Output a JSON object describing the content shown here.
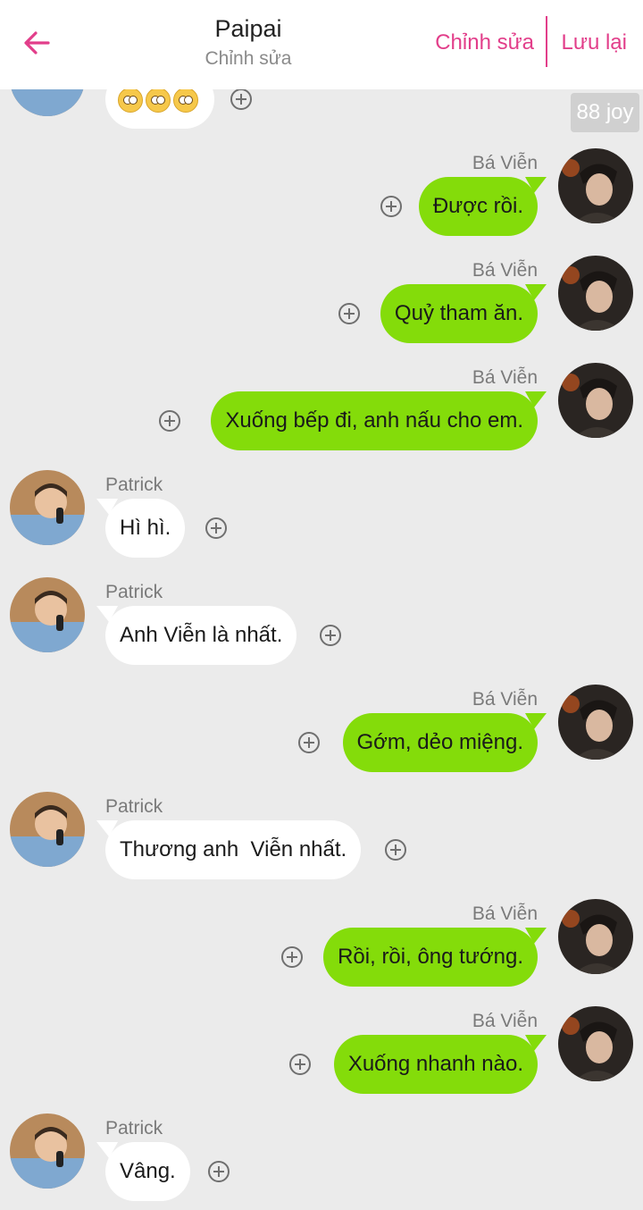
{
  "header": {
    "title": "Paipai",
    "subtitle": "Chỉnh sửa",
    "edit_label": "Chỉnh sửa",
    "save_label": "Lưu lại",
    "accent_color": "#e23e8a"
  },
  "watermark": "88 joy",
  "colors": {
    "green_bubble": "#84dc0a",
    "white_bubble": "#ffffff",
    "background": "#ebebeb"
  },
  "icons": {
    "back": "arrow-left-icon",
    "add": "plus-circle-icon",
    "emoji": "pleading-face-emoji"
  },
  "messages": [
    {
      "sender": "Patrick",
      "side": "left",
      "text": "🥺🥺🥺"
    },
    {
      "sender": "Bá Viễn",
      "side": "right",
      "text": "Được rồi."
    },
    {
      "sender": "Bá Viễn",
      "side": "right",
      "text": "Quỷ tham ăn."
    },
    {
      "sender": "Bá Viễn",
      "side": "right",
      "text": "Xuống bếp đi, anh nấu cho em."
    },
    {
      "sender": "Patrick",
      "side": "left",
      "text": "Hì hì."
    },
    {
      "sender": "Patrick",
      "side": "left",
      "text": "Anh Viễn là nhất."
    },
    {
      "sender": "Bá Viễn",
      "side": "right",
      "text": "Gớm, dẻo miệng."
    },
    {
      "sender": "Patrick",
      "side": "left",
      "text": "Thương anh  Viễn nhất."
    },
    {
      "sender": "Bá Viễn",
      "side": "right",
      "text": "Rồi, rồi, ông tướng."
    },
    {
      "sender": "Bá Viễn",
      "side": "right",
      "text": "Xuống nhanh nào."
    },
    {
      "sender": "Patrick",
      "side": "left",
      "text": "Vâng."
    }
  ]
}
